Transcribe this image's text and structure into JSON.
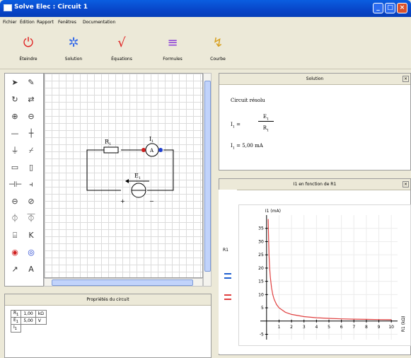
{
  "window": {
    "title": "Solve Elec : Circuit 1"
  },
  "menu": [
    "Fichier",
    "Édition",
    "Rapport",
    "Fenêtres",
    "Documentation"
  ],
  "toolbar": [
    {
      "label": "Éteindre",
      "icon": "power-icon",
      "color": "#e02020"
    },
    {
      "label": "Solution",
      "icon": "gear-icon",
      "color": "#3a6ee8"
    },
    {
      "label": "Équations",
      "icon": "sqrt-icon",
      "color": "#e02020"
    },
    {
      "label": "Formules",
      "icon": "equals-icon",
      "color": "#8a3ad8"
    },
    {
      "label": "Courbe",
      "icon": "curve-icon",
      "color": "#d8a020"
    }
  ],
  "circuit": {
    "resistor_label": "R",
    "resistor_sub": "1",
    "ammeter_label": "I",
    "ammeter_sub": "1",
    "ammeter_symbol": "A",
    "source_label": "E",
    "source_sub": "1",
    "plus": "+",
    "minus": "−"
  },
  "properties": {
    "title": "Propriétés du circuit",
    "rows": [
      {
        "name": "R",
        "sub": "1",
        "value": "1,00",
        "unit": "kΩ"
      },
      {
        "name": "E",
        "sub": "1",
        "value": "5,00",
        "unit": "V"
      },
      {
        "name": "I",
        "sub": "1",
        "value": "",
        "unit": ""
      }
    ]
  },
  "solution": {
    "title": "Solution",
    "status": "Circuit résolu",
    "eq_lhs": "I",
    "eq_sub": "1",
    "eq_num": "E",
    "eq_num_sub": "1",
    "eq_den": "R",
    "eq_den_sub": "1",
    "result_lhs": "I",
    "result_sub": "1",
    "result_value": "5,00 mA"
  },
  "graph_panel": {
    "title": "I1 en fonction de R1",
    "side_label": "R1"
  },
  "chart_data": {
    "type": "line",
    "ylabel": "I1 (mA)",
    "xlabel": "R1 (kΩ)",
    "xlim": [
      -0.5,
      10.5
    ],
    "ylim": [
      -7,
      40
    ],
    "xticks": [
      1,
      2,
      3,
      4,
      5,
      6,
      7,
      8,
      9,
      10
    ],
    "yticks": [
      -5,
      5,
      10,
      15,
      20,
      25,
      30,
      35
    ],
    "series": [
      {
        "x": [
          0.13,
          0.15,
          0.2,
          0.25,
          0.3,
          0.4,
          0.5,
          0.6,
          0.8,
          1,
          1.5,
          2,
          3,
          4,
          5,
          6,
          7,
          8,
          9,
          10
        ],
        "y": [
          38.5,
          33.3,
          25,
          20,
          16.7,
          12.5,
          10,
          8.3,
          6.25,
          5,
          3.33,
          2.5,
          1.67,
          1.25,
          1,
          0.83,
          0.71,
          0.63,
          0.56,
          0.5
        ],
        "color": "#e04040"
      }
    ]
  }
}
